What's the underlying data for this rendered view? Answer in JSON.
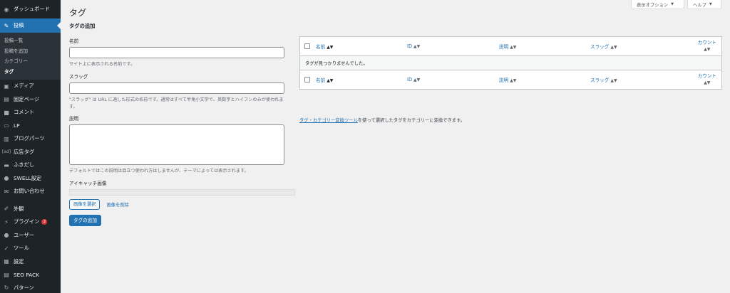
{
  "sidebar": {
    "dashboard": "ダッシュボード",
    "posts": "投稿",
    "sub": [
      "投稿一覧",
      "投稿を追加",
      "カテゴリー",
      "タグ"
    ],
    "items": [
      {
        "label": "メディア",
        "icon": "media-icon"
      },
      {
        "label": "固定ページ",
        "icon": "page-icon"
      },
      {
        "label": "コメント",
        "icon": "comment-icon"
      },
      {
        "label": "LP",
        "icon": "lp-icon"
      },
      {
        "label": "ブログパーツ",
        "icon": "blog-parts-icon"
      },
      {
        "label": "広告タグ",
        "icon": "ad-tag-icon"
      },
      {
        "label": "ふきだし",
        "icon": "balloon-icon"
      },
      {
        "label": "SWELL設定",
        "icon": "swell-icon"
      },
      {
        "label": "お問い合わせ",
        "icon": "mail-icon"
      }
    ],
    "items2": [
      {
        "label": "外観",
        "icon": "appearance-icon"
      },
      {
        "label": "プラグイン",
        "icon": "plugin-icon",
        "badge": "2"
      },
      {
        "label": "ユーザー",
        "icon": "user-icon"
      },
      {
        "label": "ツール",
        "icon": "tool-icon"
      },
      {
        "label": "設定",
        "icon": "settings-icon"
      },
      {
        "label": "SEO PACK",
        "icon": "seo-icon"
      },
      {
        "label": "パターン",
        "icon": "pattern-icon"
      }
    ]
  },
  "header": {
    "screen_options": "表示オプション",
    "help": "ヘルプ"
  },
  "page": {
    "title": "タグ"
  },
  "form": {
    "heading": "タグの追加",
    "name_label": "名前",
    "name_desc": "サイト上に表示される名前です。",
    "slug_label": "スラッグ",
    "slug_desc": "\"スラッグ\" は URL に適した形式の名前です。通常はすべて半角小文字で、英数字とハイフンのみが使われます。",
    "desc_label": "説明",
    "desc_desc": "デフォルトではこの説明は目立つ使われ方はしませんが、テーマによっては表示されます。",
    "image_label": "アイキャッチ画像",
    "select_image": "画像を選択",
    "remove_image": "画像を削除",
    "submit": "タグの追加"
  },
  "table": {
    "columns": [
      "名前",
      "ID",
      "説明",
      "スラッグ",
      "カウント"
    ],
    "empty": "タグが見つかりませんでした。"
  },
  "note": {
    "link": "タグ・カテゴリー変換ツール",
    "text": "を使って選択したタグをカテゴリーに変換できます。"
  }
}
